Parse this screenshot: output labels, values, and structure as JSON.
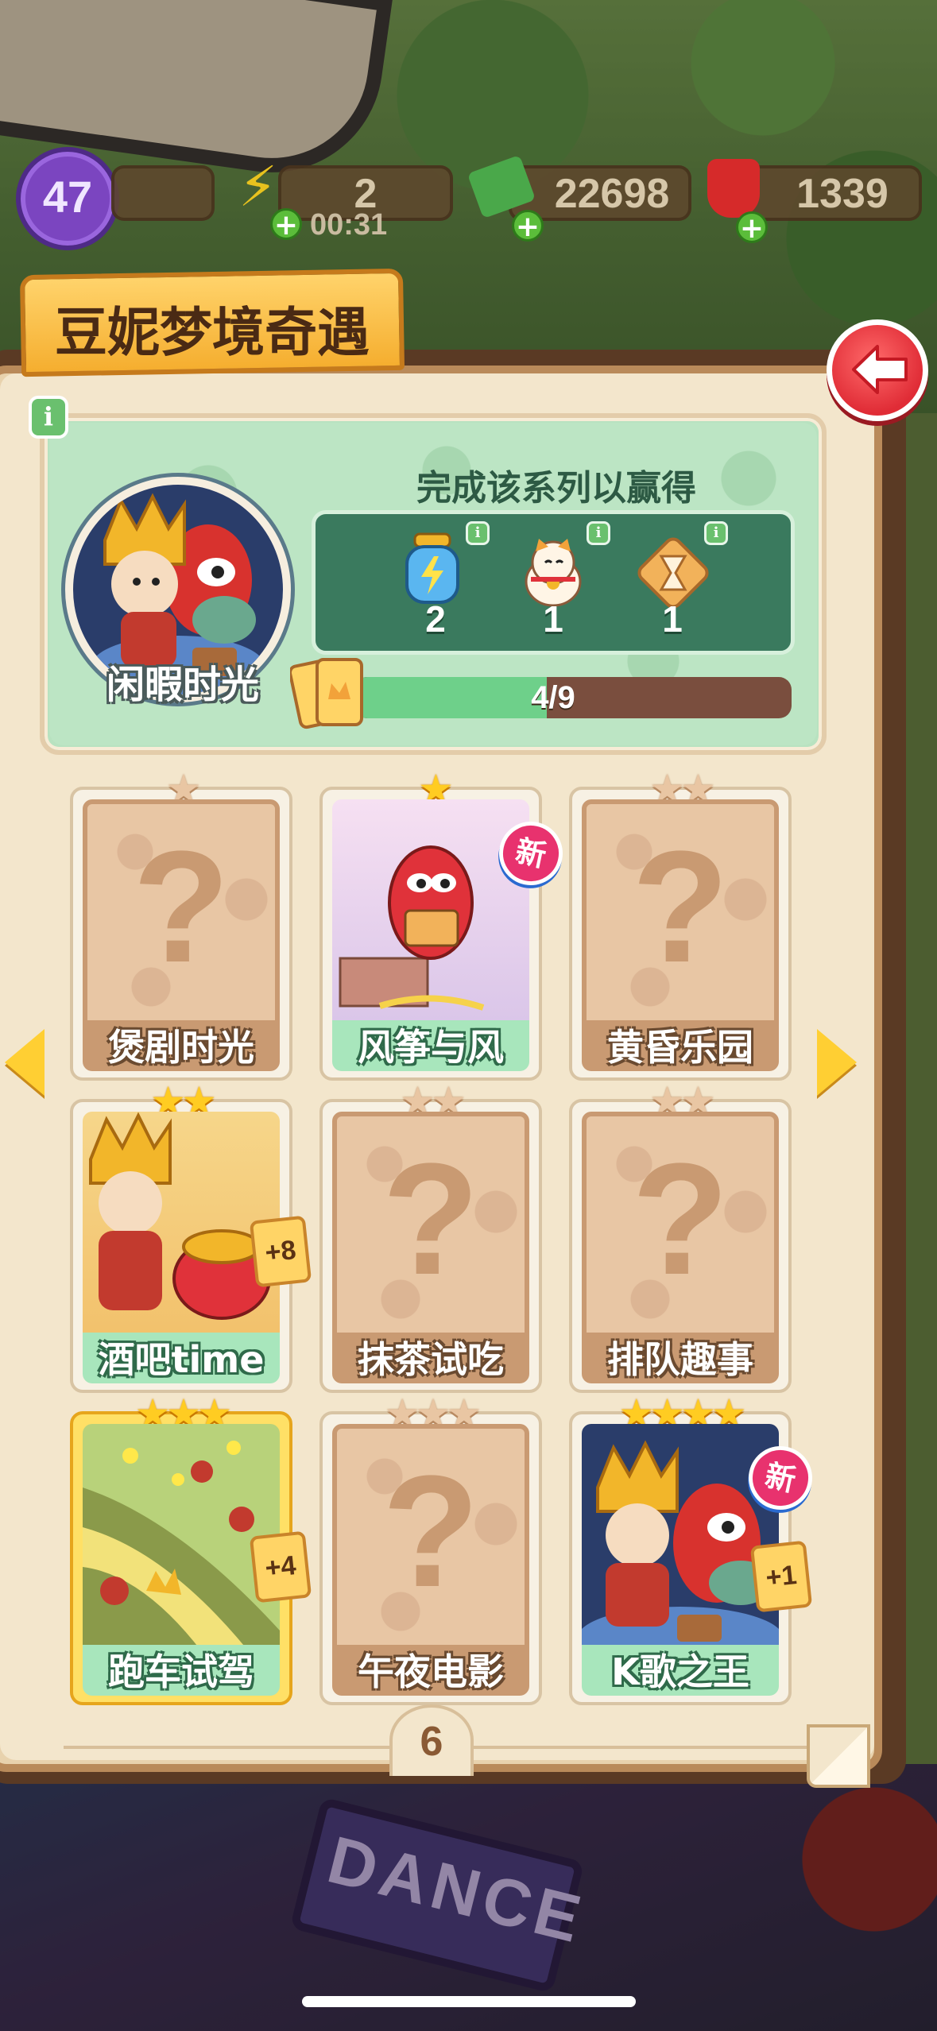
{
  "hud": {
    "level": "47",
    "energy": "2",
    "energy_timer": "00:31",
    "cash": "22698",
    "gems": "1339"
  },
  "panel": {
    "title": "豆妮梦境奇遇",
    "reward_title": "完成该系列以赢得",
    "series_name": "闲暇时光",
    "progress_text": "4/9",
    "progress_fraction": 0.44,
    "rewards": [
      {
        "icon": "energy-bottle-icon",
        "qty": "2"
      },
      {
        "icon": "lucky-cat-icon",
        "qty": "1"
      },
      {
        "icon": "hourglass-icon",
        "qty": "1"
      }
    ],
    "page_number": "6"
  },
  "cards": [
    {
      "label": "煲剧时光",
      "stars": 1,
      "owned": false
    },
    {
      "label": "风筝与风",
      "stars": 1,
      "owned": true,
      "new": true,
      "new_label": "新"
    },
    {
      "label": "黄昏乐园",
      "stars": 2,
      "owned": false
    },
    {
      "label": "酒吧time",
      "stars": 2,
      "owned": true,
      "extra": "+8"
    },
    {
      "label": "抹茶试吃",
      "stars": 2,
      "owned": false
    },
    {
      "label": "排队趣事",
      "stars": 2,
      "owned": false
    },
    {
      "label": "跑车试驾",
      "stars": 3,
      "owned": true,
      "gold": true,
      "extra": "+4"
    },
    {
      "label": "午夜电影",
      "stars": 3,
      "owned": false
    },
    {
      "label": "K歌之王",
      "stars": 4,
      "owned": true,
      "new": true,
      "new_label": "新",
      "extra": "+1"
    }
  ],
  "colors": {
    "accent_gold": "#ffcf33",
    "back_red": "#e02c36",
    "reward_green": "#3a7a5e",
    "progress_fill": "#6ed08a"
  },
  "background": {
    "sign_text": "DANCE"
  }
}
